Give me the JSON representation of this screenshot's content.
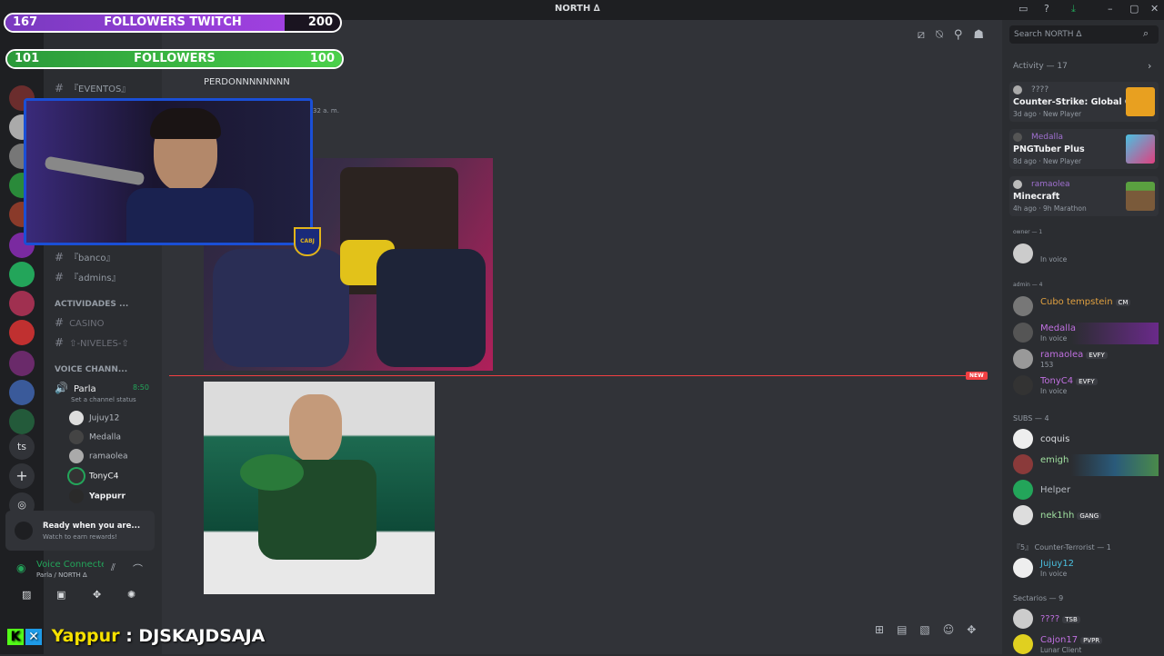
{
  "titlebar": {
    "server": "NORTH ∆"
  },
  "search": {
    "placeholder": "Search NORTH ∆"
  },
  "overlays": {
    "twitch": {
      "left": "167",
      "label": "FOLLOWERS TWITCH",
      "right": "200",
      "progress": 0.835
    },
    "followers": {
      "left": "101",
      "label": "FOLLOWERS",
      "right": "100",
      "progress": 1.0
    }
  },
  "chat": {
    "message_text": "PERDONNNNNNNN",
    "timestamp_frag": "32 a. m.",
    "new_label": "NEW"
  },
  "channels": {
    "eventos": "『EVENTOS』",
    "banco": "『banco』",
    "admins": "『admins』",
    "cat_actividades": "ACTIVIDADES ...",
    "casino": "CASINO",
    "niveles": "⇧-NIVELES-⇧",
    "cat_voice": "VOICE CHANN...",
    "parla": "Parla",
    "parla_time": "8:50",
    "channel_status": "Set a channel status",
    "voice_users": [
      "Jujuy12",
      "Medalla",
      "ramaolea",
      "TonyC4",
      "Yappurr"
    ]
  },
  "popup": {
    "title": "Ready when you are...",
    "subtitle": "Watch to earn rewards!"
  },
  "voice": {
    "status": "Voice Connected",
    "location": "Parla / NORTH ∆"
  },
  "guild_text": {
    "ts": "ts"
  },
  "activity": {
    "header": "Activity — 17",
    "items": [
      {
        "who": "????",
        "game": "Counter-Strike: Global Off...",
        "meta": "3d ago · New Player"
      },
      {
        "who": "Medalla",
        "game": "PNGTuber Plus",
        "meta": "8d ago · New Player"
      },
      {
        "who": "ramaolea",
        "game": "Minecraft",
        "meta": "4h ago · 9h Marathon"
      }
    ]
  },
  "members": {
    "owner_header": "owner — 1",
    "admin_header": "admin — 4",
    "subs_header": "SUBS — 4",
    "ct_header": "『5』 Counter-Terrorist — 1",
    "sect_header": "Sectarios — 9",
    "owner": [
      {
        "name": "",
        "status": "In voice"
      }
    ],
    "admins": [
      {
        "name": "Cubo tempstein",
        "tag": "CM",
        "status": ""
      },
      {
        "name": "Medalla",
        "tag": "",
        "status": "In voice"
      },
      {
        "name": "ramaolea",
        "tag": "EVFY",
        "status": "153"
      },
      {
        "name": "TonyC4",
        "tag": "EVFY",
        "status": "In voice"
      }
    ],
    "subs": [
      {
        "name": "coquis",
        "tag": ""
      },
      {
        "name": "emigh",
        "tag": ""
      },
      {
        "name": "Helper",
        "tag": ""
      },
      {
        "name": "nek1hh",
        "tag": "GANG"
      }
    ],
    "ct": [
      {
        "name": "Jujuy12",
        "status": "In voice"
      }
    ],
    "sectarios": [
      {
        "name": "????",
        "tag": "TSB",
        "status": ""
      },
      {
        "name": "Cajon17",
        "tag": "PVPR",
        "status": "Lunar Client"
      }
    ]
  },
  "ticker": {
    "user": "Yappur",
    "sep": ":",
    "message": "DJSKAJDSAJA"
  }
}
